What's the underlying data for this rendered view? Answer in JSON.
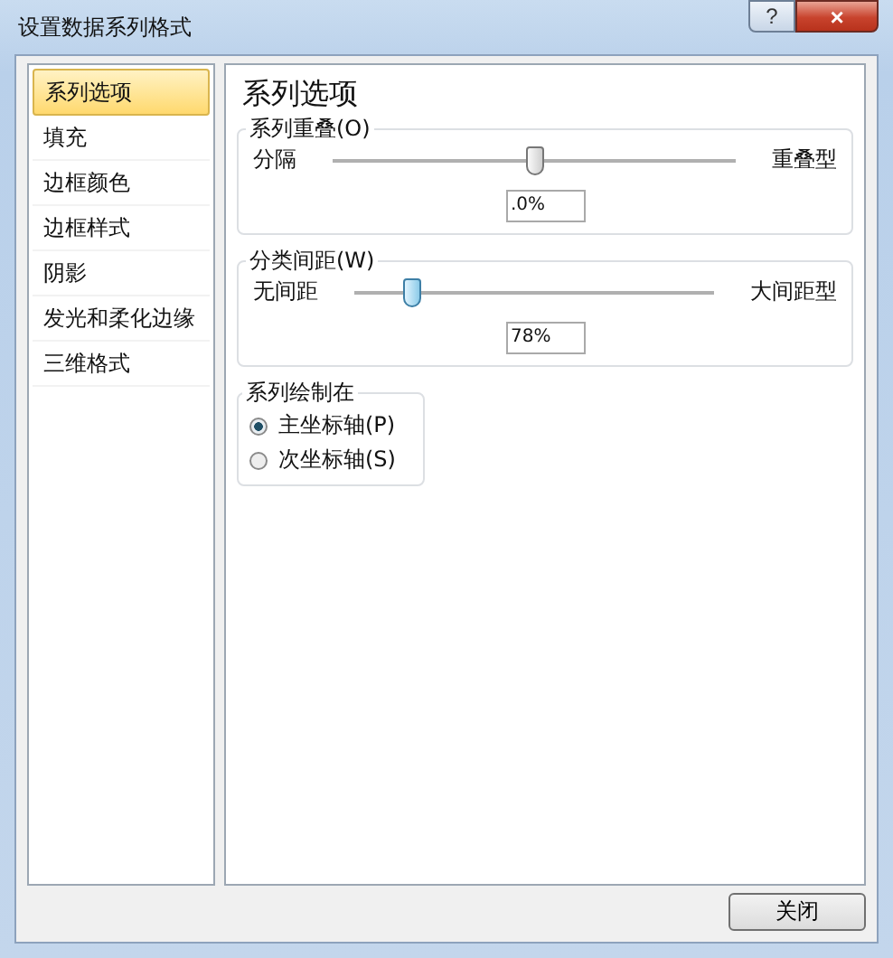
{
  "window": {
    "title": "设置数据系列格式",
    "help_button": "?",
    "close_button": "×"
  },
  "sidebar": {
    "items": [
      {
        "label": "系列选项",
        "selected": true
      },
      {
        "label": "填充",
        "selected": false
      },
      {
        "label": "边框颜色",
        "selected": false
      },
      {
        "label": "边框样式",
        "selected": false
      },
      {
        "label": "阴影",
        "selected": false
      },
      {
        "label": "发光和柔化边缘",
        "selected": false
      },
      {
        "label": "三维格式",
        "selected": false
      }
    ]
  },
  "panel": {
    "heading": "系列选项",
    "sliders": [
      {
        "legend": "系列重叠(O)",
        "min_label": "分隔",
        "max_label": "重叠型",
        "level": 0.5,
        "value": ".0%",
        "active": false
      },
      {
        "legend": "分类间距(W)",
        "min_label": "无间距",
        "max_label": "大间距型",
        "level": 0.16,
        "value": "78%",
        "active": true
      }
    ],
    "plot_on": {
      "legend": "系列绘制在",
      "options": [
        {
          "label": "主坐标轴(P)",
          "selected": true
        },
        {
          "label": "次坐标轴(S)",
          "selected": false
        }
      ]
    }
  },
  "buttons": [
    "关闭"
  ]
}
